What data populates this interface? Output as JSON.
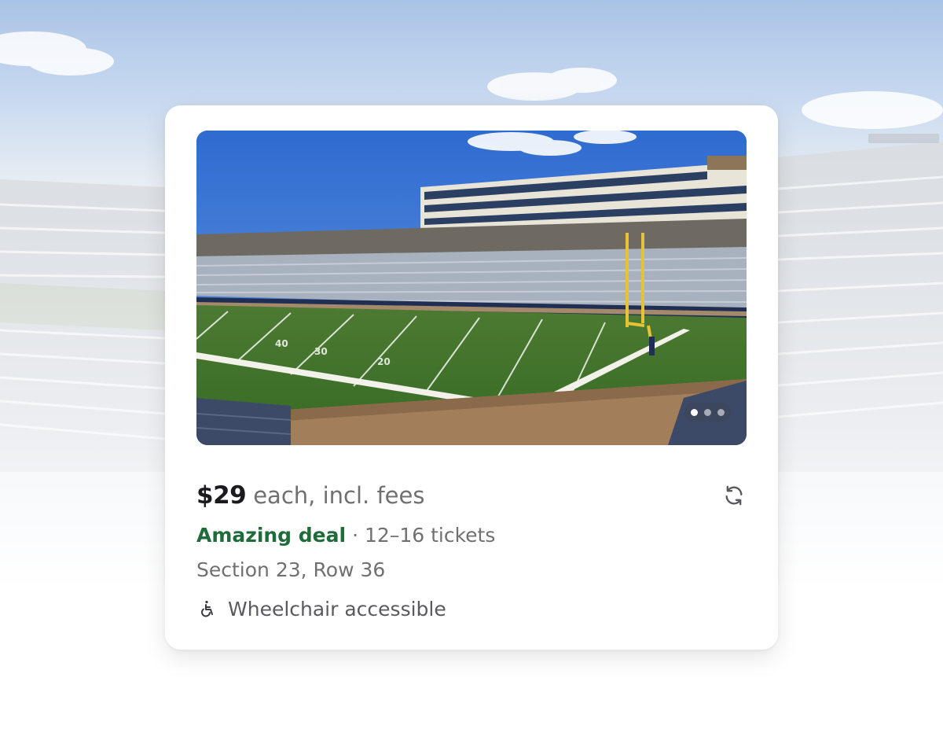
{
  "listing": {
    "price": "$29",
    "price_suffix": "each, incl. fees",
    "deal_label": "Amazing deal",
    "separator": "·",
    "ticket_range": "12–16 tickets",
    "location": "Section 23, Row 36",
    "feature": "Wheelchair accessible",
    "feature_icon": "wheelchair-icon",
    "refresh_icon": "refresh-icon"
  },
  "carousel": {
    "image_count": 3,
    "active_index": 0
  },
  "colors": {
    "deal_green": "#1f6b3a",
    "price_text": "#1b1b1f",
    "muted_text": "#707070"
  }
}
